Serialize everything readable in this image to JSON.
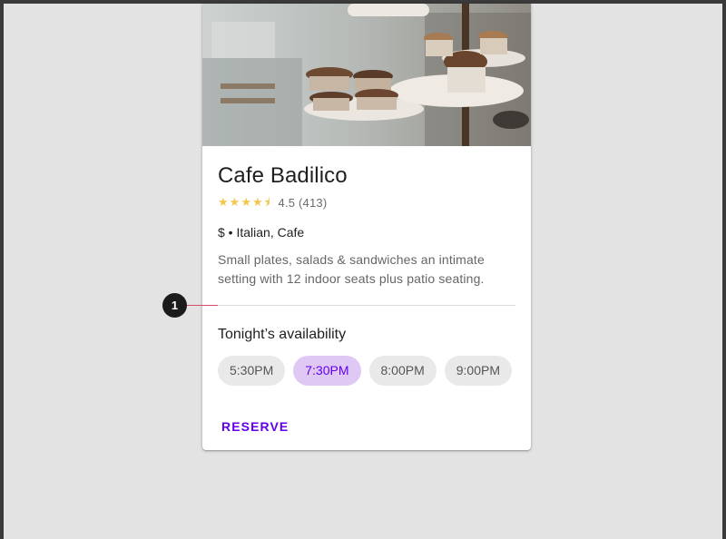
{
  "card": {
    "title": "Cafe Badilico",
    "rating": {
      "value": 4.5,
      "display": "4.5 (413)",
      "max": 5
    },
    "meta": "$ • Italian, Cafe",
    "description": "Small plates, salads & sandwiches an intimate setting with 12 indoor seats plus patio seating.",
    "availability_title": "Tonight’s availability",
    "times": [
      {
        "label": "5:30PM",
        "selected": false
      },
      {
        "label": "7:30PM",
        "selected": true
      },
      {
        "label": "8:00PM",
        "selected": false
      },
      {
        "label": "9:00PM",
        "selected": false
      }
    ],
    "action_label": "RESERVE"
  },
  "callout": {
    "number": "1"
  },
  "icons": {
    "rating": "star-icon",
    "image": "cafe-pastries-photo"
  },
  "colors": {
    "accent": "#6200ee",
    "chip_selected_bg": "#dfc9f4",
    "star": "#f1c84c",
    "callout_line": "#d74b6e",
    "background": "#e3e3e3"
  }
}
